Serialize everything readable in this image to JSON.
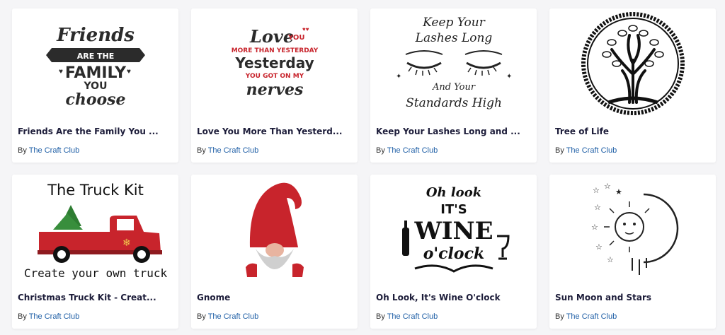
{
  "by_prefix": "By",
  "colors": {
    "accent": "#1f5fa6",
    "title": "#1d1d3a",
    "red": "#c8242c",
    "dark": "#2b2b2b"
  },
  "cards": [
    {
      "title": "Friends Are the Family You ...",
      "author": "The Craft Club",
      "art": {
        "lines": [
          "Friends",
          "ARE THE",
          "FAMILY",
          "YOU",
          "choose"
        ]
      }
    },
    {
      "title": "Love You More Than Yesterd...",
      "author": "The Craft Club",
      "art": {
        "lines": [
          "Love",
          "YOU",
          "MORE THAN YESTERDAY",
          "Yesterday",
          "YOU GOT ON MY",
          "nerves"
        ]
      }
    },
    {
      "title": "Keep Your Lashes Long and ...",
      "author": "The Craft Club",
      "art": {
        "lines": [
          "Keep Your",
          "Lashes Long",
          "And Your",
          "Standards High"
        ]
      }
    },
    {
      "title": "Tree of Life",
      "author": "The Craft Club",
      "art": {
        "icon": "tree-of-life-icon"
      }
    },
    {
      "title": "Christmas Truck Kit - Creat...",
      "author": "The Craft Club",
      "art": {
        "lines": [
          "The Truck Kit",
          "Create your own truck"
        ]
      }
    },
    {
      "title": "Gnome",
      "author": "The Craft Club",
      "art": {
        "icon": "gnome-icon"
      }
    },
    {
      "title": "Oh Look, It's Wine O'clock",
      "author": "The Craft Club",
      "art": {
        "lines": [
          "Oh look",
          "IT'S",
          "WINE",
          "o'clock"
        ]
      }
    },
    {
      "title": "Sun Moon and Stars",
      "author": "The Craft Club",
      "art": {
        "icon": "sun-moon-stars-icon"
      }
    }
  ]
}
